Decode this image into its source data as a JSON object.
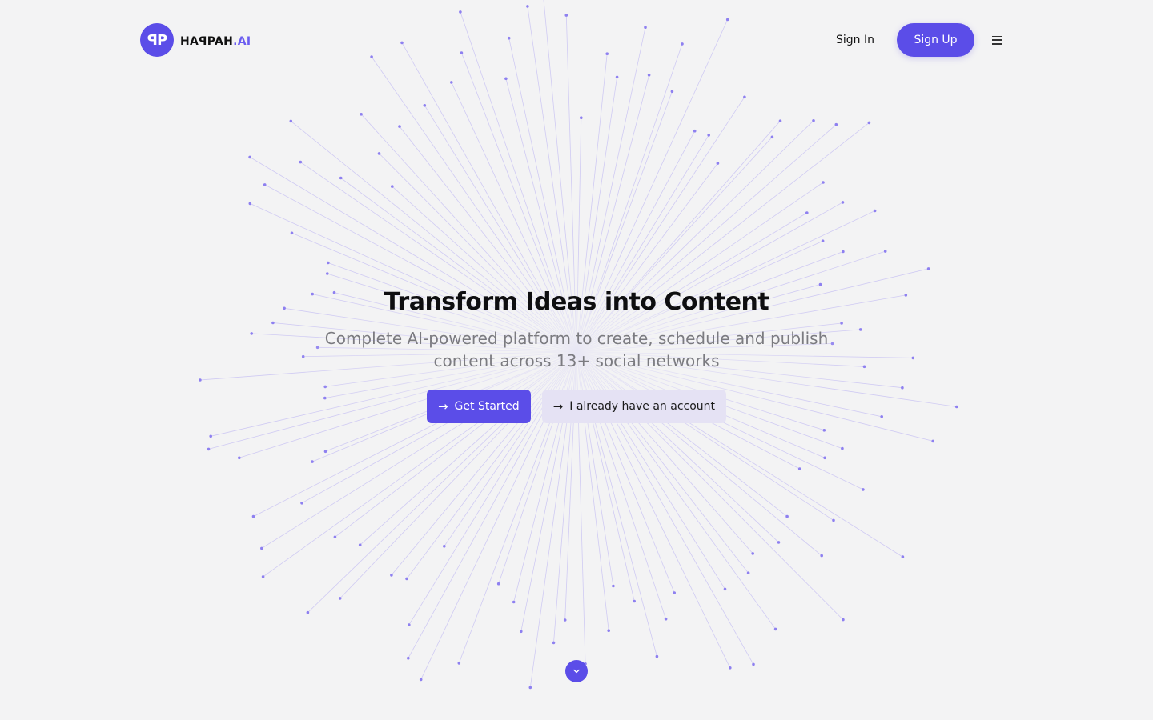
{
  "brand": {
    "logo_mark": "ꟼP",
    "name": "HAꟼPAH",
    "suffix": ".AI"
  },
  "nav": {
    "sign_in": "Sign In",
    "sign_up": "Sign Up",
    "menu_icon": "hamburger-menu-icon"
  },
  "hero": {
    "title": "Transform Ideas into Content",
    "subtitle": "Complete AI-powered platform to create, schedule and publish content across 13+ social networks",
    "primary_cta": "Get Started",
    "secondary_cta": "I already have an account",
    "cta_icon": "arrow-right-icon"
  },
  "scroll": {
    "icon": "chevron-down-icon"
  },
  "colors": {
    "accent": "#5b4de8",
    "background": "#f3f3f4",
    "ray": "#b3aaf2",
    "dot": "#8e80f0"
  }
}
